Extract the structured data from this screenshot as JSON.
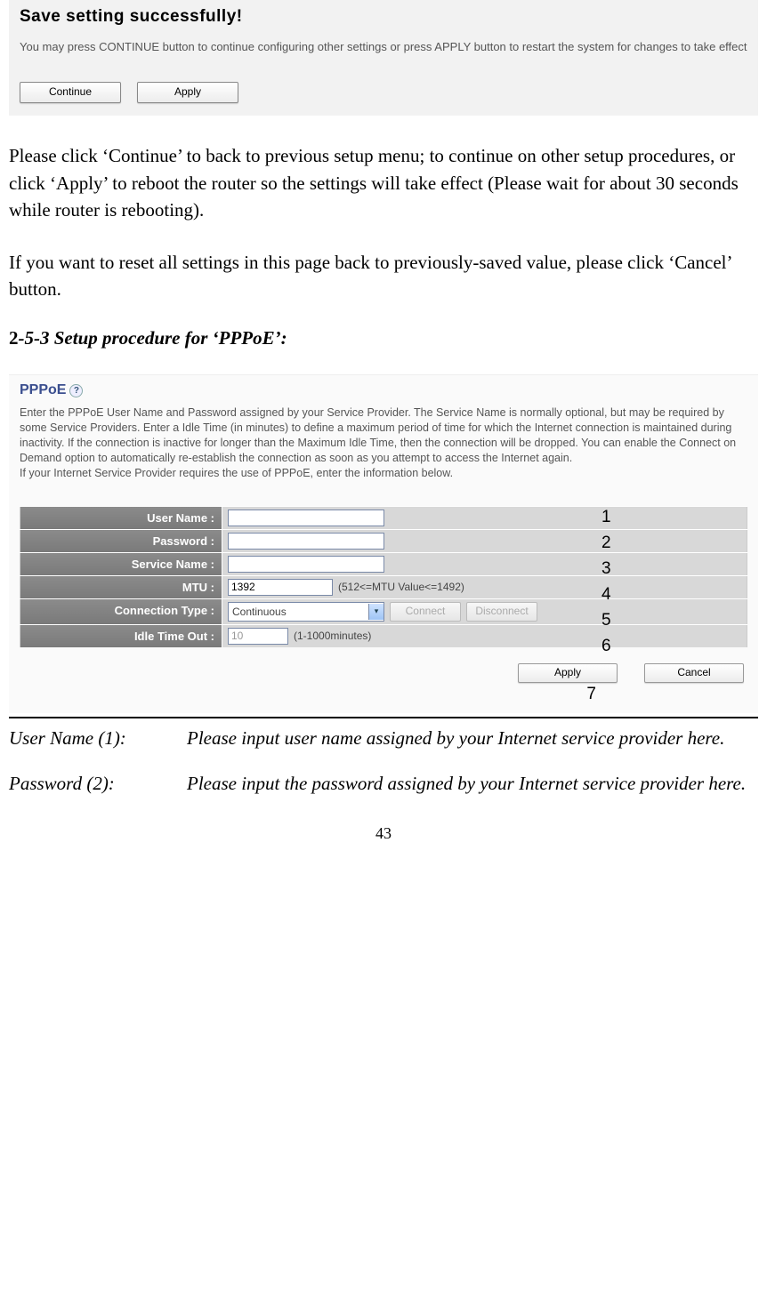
{
  "save_box": {
    "title": "Save setting successfully!",
    "subtitle": "You may press CONTINUE button to continue configuring other settings or press APPLY button to restart the system for changes to take effect",
    "continue_btn": "Continue",
    "apply_btn": "Apply"
  },
  "para1": "Please click ‘Continue’ to back to previous setup menu; to continue on other setup procedures, or click ‘Apply’ to reboot the router so the settings will take effect (Please wait for about 30 seconds while router is rebooting).",
  "para2": "If you want to reset all settings in this page back to previously-saved value, please click ‘Cancel’ button.",
  "section_heading_prefix": "2",
  "section_heading_rest": "-5-3 Setup procedure for ‘PPPoE’:",
  "pppoe": {
    "title": "PPPoE",
    "help": "?",
    "desc": "Enter the PPPoE User Name and Password assigned by your Service Provider. The Service Name is normally optional, but may be required by some Service Providers. Enter a Idle Time (in minutes) to define a maximum period of time for which the Internet connection is maintained during inactivity. If the connection is inactive for longer than the Maximum Idle Time, then the connection will be dropped. You can enable the Connect on Demand option to automatically re-establish the connection as soon as you attempt to access the Internet again.\nIf your Internet Service Provider requires the use of PPPoE, enter the information below.",
    "rows": {
      "username_label": "User Name :",
      "password_label": "Password :",
      "service_label": "Service Name :",
      "mtu_label": "MTU :",
      "mtu_value": "1392",
      "mtu_hint": "(512<=MTU Value<=1492)",
      "conn_label": "Connection Type :",
      "conn_value": "Continuous",
      "connect_btn": "Connect",
      "disconnect_btn": "Disconnect",
      "idle_label": "Idle Time Out :",
      "idle_value": "10",
      "idle_hint": "(1-1000minutes)"
    },
    "apply_btn": "Apply",
    "cancel_btn": "Cancel",
    "numbers": {
      "n1": "1",
      "n2": "2",
      "n3": "3",
      "n4": "4",
      "n5": "5",
      "n6": "6",
      "n7": "7"
    }
  },
  "defs": {
    "username_term": "User Name (1):",
    "username_desc": "Please input user name assigned by your Internet service provider here.",
    "password_term": "Password (2):",
    "password_desc": "Please input the password assigned by your Internet service provider here."
  },
  "page_number": "43"
}
